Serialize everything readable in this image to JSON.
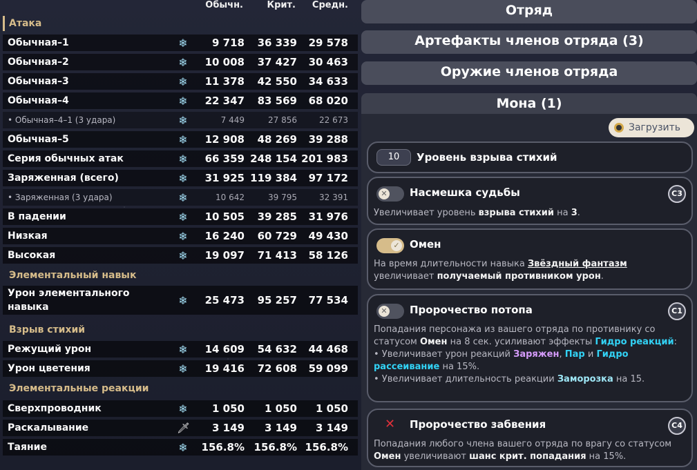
{
  "columns": {
    "normal": "Обычн.",
    "crit": "Крит.",
    "avg": "Средн."
  },
  "sections": {
    "attack": "Атака",
    "skill": "Элементальный навык",
    "burst": "Взрыв стихий",
    "reactions": "Элементальные реакции"
  },
  "rows": [
    {
      "label": "Обычная–1",
      "icon": "hydro-icon",
      "n": "9 718",
      "c": "36 339",
      "a": "29 578"
    },
    {
      "label": "Обычная–2",
      "icon": "hydro-icon",
      "n": "10 008",
      "c": "37 427",
      "a": "30 463"
    },
    {
      "label": "Обычная–3",
      "icon": "hydro-icon",
      "n": "11 378",
      "c": "42 550",
      "a": "34 633"
    },
    {
      "label": "Обычная–4",
      "icon": "hydro-icon",
      "n": "22 347",
      "c": "83 569",
      "a": "68 020"
    },
    {
      "label": "• Обычная–4–1 (3 удара)",
      "icon": "hydro-icon",
      "n": "7 449",
      "c": "27 856",
      "a": "22 673"
    },
    {
      "label": "Обычная–5",
      "icon": "hydro-icon",
      "n": "12 908",
      "c": "48 269",
      "a": "39 288"
    },
    {
      "label": "Серия обычных атак",
      "icon": "hydro-icon",
      "n": "66 359",
      "c": "248 154",
      "a": "201 983"
    },
    {
      "label": "Заряженная (всего)",
      "icon": "hydro-icon",
      "n": "31 925",
      "c": "119 384",
      "a": "97 172"
    },
    {
      "label": "• Заряженная (3 удара)",
      "icon": "hydro-icon",
      "n": "10 642",
      "c": "39 795",
      "a": "32 391"
    },
    {
      "label": "В падении",
      "icon": "hydro-icon",
      "n": "10 505",
      "c": "39 285",
      "a": "31 976"
    },
    {
      "label": "Низкая",
      "icon": "hydro-icon",
      "n": "16 240",
      "c": "60 729",
      "a": "49 430"
    },
    {
      "label": "Высокая",
      "icon": "hydro-icon",
      "n": "19 097",
      "c": "71 413",
      "a": "58 126"
    },
    {
      "label": "Урон элементального навыка",
      "icon": "hydro-icon",
      "n": "25 473",
      "c": "95 257",
      "a": "77 534"
    },
    {
      "label": "Режущий урон",
      "icon": "hydro-icon",
      "n": "14 609",
      "c": "54 632",
      "a": "44 468"
    },
    {
      "label": "Урон цветения",
      "icon": "hydro-icon",
      "n": "19 416",
      "c": "72 608",
      "a": "59 099"
    },
    {
      "label": "Сверхпроводник",
      "icon": "hydro-icon",
      "n": "1 050",
      "c": "1 050",
      "a": "1 050"
    },
    {
      "label": "Раскалывание",
      "icon": "sword-icon",
      "n": "3 149",
      "c": "3 149",
      "a": "3 149"
    },
    {
      "label": "Таяние",
      "icon": "hydro-icon",
      "n": "156.8%",
      "c": "156.8%",
      "a": "156.8%"
    }
  ],
  "right": {
    "team": "Отряд",
    "artifacts": "Артефакты членов отряда (3)",
    "weapons": "Оружие членов отряда",
    "character": "Мона (1)",
    "load": "Загрузить",
    "burst_level": {
      "value": "10",
      "label": "Уровень взрыва стихий"
    },
    "c3": {
      "title": "Насмешка судьбы",
      "badge": "C3",
      "d1": "Увеличивает уровень ",
      "d2": "взрыва стихий",
      "d3": " на ",
      "d4": "3",
      "d5": "."
    },
    "omen": {
      "title": "Омен",
      "d1": "На время длительности навыка ",
      "d2": "Звёздный фантазм",
      "d3": "увеличивает ",
      "d4": "получаемый противником урон",
      "d5": "."
    },
    "c1": {
      "title": "Пророчество потопа",
      "badge": "C1",
      "d1": "Попадания персонажа из вашего отряда по противнику со статусом ",
      "d2": "Омен",
      "d3": " на 8 сек. усиливают эффекты ",
      "d4": "Гидро реакций",
      "d5": ":",
      "l1a": "• Увеличивает урон реакций ",
      "l1b": "Заряжен",
      "l1c": ", ",
      "l1d": "Пар",
      "l1e": " и ",
      "l1f": "Гидро рассеивание",
      "l1g": " на 15%.",
      "l2a": "• Увеличивает длительность реакции ",
      "l2b": "Заморозка",
      "l2c": " на 15."
    },
    "c4": {
      "title": "Пророчество забвения",
      "badge": "C4",
      "d1": "Попадания любого члена вашего отряда по врагу со статусом ",
      "d2": "Омен",
      "d3": " увеличивают ",
      "d4": "шанс крит. попадания",
      "d5": " на 15%."
    }
  }
}
